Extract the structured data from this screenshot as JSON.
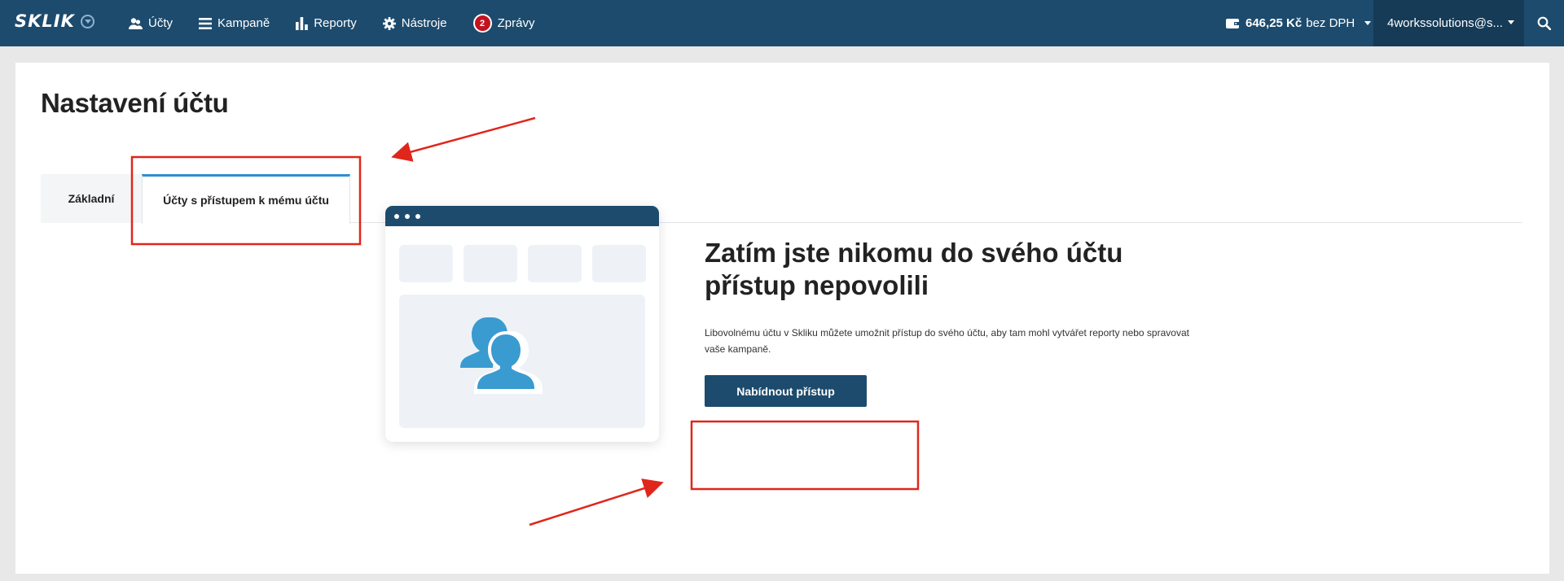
{
  "header": {
    "logo": "SKLIK",
    "nav": [
      {
        "label": "Účty",
        "icon": "users-icon"
      },
      {
        "label": "Kampaně",
        "icon": "list-icon"
      },
      {
        "label": "Reporty",
        "icon": "bar-chart-icon"
      },
      {
        "label": "Nástroje",
        "icon": "gear-icon"
      },
      {
        "label": "Zprávy",
        "icon": "notification-badge",
        "badge": "2"
      }
    ],
    "credit": {
      "amount": "646,25 Kč",
      "suffix": "bez DPH",
      "icon": "wallet-icon"
    },
    "account": "4workssolutions@s...",
    "search_icon": "search-icon"
  },
  "page": {
    "title": "Nastavení účtu"
  },
  "tabs": [
    {
      "label": "Základní",
      "active": false
    },
    {
      "label": "Účty s přístupem k mému účtu",
      "active": true
    }
  ],
  "empty_state": {
    "title": "Zatím jste nikomu do svého účtu přístup nepovolili",
    "description": "Libovolnému účtu v Skliku můžete umožnit přístup do svého účtu, aby tam mohl vytvářet reporty nebo spravovat vaše kampaně.",
    "button": "Nabídnout přístup",
    "illustration_icon": "users-icon"
  },
  "colors": {
    "header": "#1d4b6d",
    "header_dark": "#163b57",
    "tab_accent": "#2d8fd5",
    "badge": "#c4131e",
    "illustration_person": "#3a9bd1",
    "annotation": "#e0261b"
  }
}
